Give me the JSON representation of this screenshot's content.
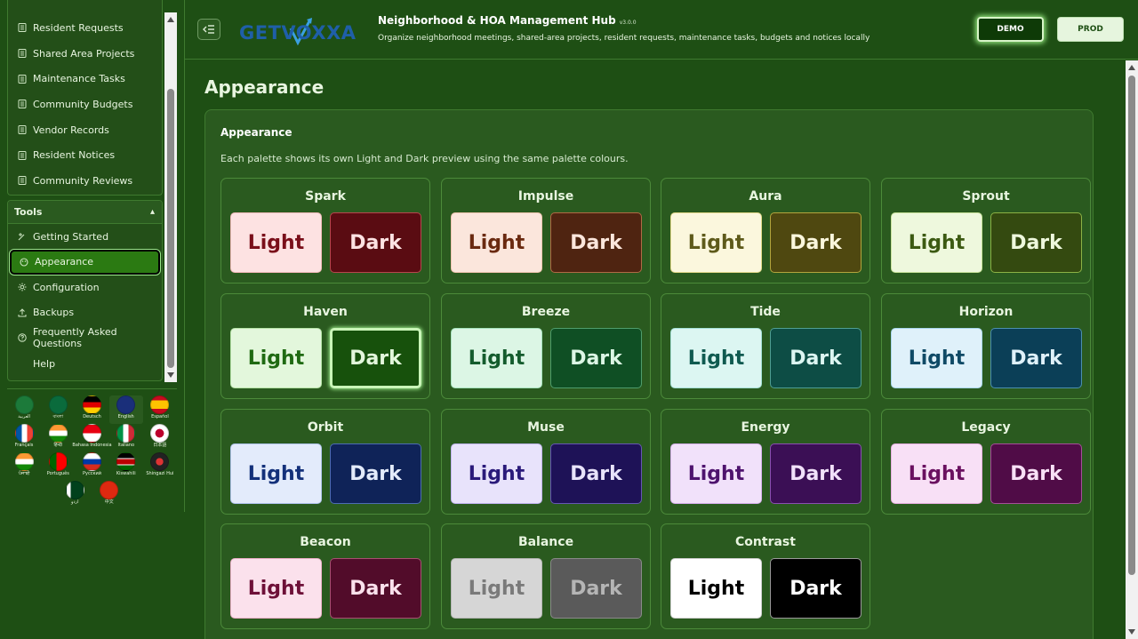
{
  "sidebar": {
    "top_items": [
      {
        "label": "Resident Requests",
        "icon": "list-icon"
      },
      {
        "label": "Shared Area Projects",
        "icon": "list-icon"
      },
      {
        "label": "Maintenance Tasks",
        "icon": "list-icon"
      },
      {
        "label": "Community Budgets",
        "icon": "list-icon"
      },
      {
        "label": "Vendor Records",
        "icon": "list-icon"
      },
      {
        "label": "Resident Notices",
        "icon": "list-icon"
      },
      {
        "label": "Community Reviews",
        "icon": "list-icon"
      }
    ],
    "tools_title": "Tools",
    "tools_items": [
      {
        "label": "Getting Started",
        "icon": "wand-icon"
      },
      {
        "label": "Appearance",
        "icon": "palette-icon",
        "active": true
      },
      {
        "label": "Configuration",
        "icon": "gear-icon"
      },
      {
        "label": "Backups",
        "icon": "upload-icon"
      },
      {
        "label": "Frequently Asked Questions",
        "icon": "question-icon"
      },
      {
        "label": "Help",
        "icon": ""
      }
    ],
    "languages": [
      [
        "العربية",
        "বাংলা",
        "Deutsch",
        "English",
        "Español"
      ],
      [
        "Français",
        "हिन्दी",
        "Bahasa Indonesia",
        "Italiano",
        "日本語"
      ],
      [
        "ਪੰਜਾਬੀ",
        "Português",
        "Русский",
        "Kiswahili",
        "Shingazi Hui"
      ],
      [
        "اردو",
        "中文"
      ]
    ]
  },
  "header": {
    "logo_text": "GETVOXXA",
    "title": "Neighborhood & HOA Management Hub",
    "version": "v3.0.0",
    "subtitle": "Organize neighborhood meetings, shared-area projects, resident requests, maintenance tasks, budgets and notices locally",
    "demo_label": "DEMO",
    "prod_label": "PROD"
  },
  "main": {
    "page_title": "Appearance",
    "card_title": "Appearance",
    "card_desc": "Each palette shows its own Light and Dark preview using the same palette colours.",
    "light_label": "Light",
    "dark_label": "Dark",
    "palettes": [
      {
        "name": "Spark",
        "light_bg": "#fde2e2",
        "light_fg": "#7a0f1a",
        "light_border": "#f2b9b9",
        "dark_bg": "#5a0c12",
        "dark_fg": "#fde2e2",
        "dark_border": "#b8454d"
      },
      {
        "name": "Impulse",
        "light_bg": "#fbe6dc",
        "light_fg": "#6a2a10",
        "light_border": "#eec3ae",
        "dark_bg": "#4f2411",
        "dark_fg": "#fbe6dc",
        "dark_border": "#b06a45"
      },
      {
        "name": "Aura",
        "light_bg": "#fbf7dd",
        "light_fg": "#5e5a1a",
        "light_border": "#e3d98a",
        "dark_bg": "#4f4810",
        "dark_fg": "#fbf7dd",
        "dark_border": "#b3a53d"
      },
      {
        "name": "Sprout",
        "light_bg": "#eef8dd",
        "light_fg": "#3c5a12",
        "light_border": "#c7e29a",
        "dark_bg": "#344a10",
        "dark_fg": "#eef8dd",
        "dark_border": "#8cb245"
      },
      {
        "name": "Haven",
        "light_bg": "#e3f7dc",
        "light_fg": "#1f6a12",
        "light_border": "#b7e3a8",
        "dark_bg": "#17510c",
        "dark_fg": "#e3f7dc",
        "dark_border": "#5fa04a"
      },
      {
        "name": "Breeze",
        "light_bg": "#dcf6e5",
        "light_fg": "#145c2d",
        "light_border": "#a7e2bd",
        "dark_bg": "#0f4f24",
        "dark_fg": "#dcf6e5",
        "dark_border": "#4f9d6c"
      },
      {
        "name": "Tide",
        "light_bg": "#dcf6f2",
        "light_fg": "#0f5a50",
        "light_border": "#a5e0d7",
        "dark_bg": "#0d4d45",
        "dark_fg": "#dcf6f2",
        "dark_border": "#4f9e93"
      },
      {
        "name": "Horizon",
        "light_bg": "#dff1fa",
        "light_fg": "#0f4a66",
        "light_border": "#a8d6ec",
        "dark_bg": "#0b3f57",
        "dark_fg": "#dff1fa",
        "dark_border": "#4c8fae"
      },
      {
        "name": "Orbit",
        "light_bg": "#e3ebfb",
        "light_fg": "#13307a",
        "light_border": "#b0c3ee",
        "dark_bg": "#0f2358",
        "dark_fg": "#e3ebfb",
        "dark_border": "#4d6cb3"
      },
      {
        "name": "Muse",
        "light_bg": "#e8e3fb",
        "light_fg": "#2a1a7a",
        "light_border": "#c0b3ef",
        "dark_bg": "#1e1257",
        "dark_fg": "#e8e3fb",
        "dark_border": "#6656b3"
      },
      {
        "name": "Energy",
        "light_bg": "#f1e1fa",
        "light_fg": "#4e136e",
        "light_border": "#d6afec",
        "dark_bg": "#3b0f55",
        "dark_fg": "#f1e1fa",
        "dark_border": "#8a4fb0"
      },
      {
        "name": "Legacy",
        "light_bg": "#f8e0f6",
        "light_fg": "#6a1060",
        "light_border": "#e7afe0",
        "dark_bg": "#500c47",
        "dark_fg": "#f8e0f6",
        "dark_border": "#a54e98"
      },
      {
        "name": "Beacon",
        "light_bg": "#fbe1ec",
        "light_fg": "#6e1038",
        "light_border": "#eeb1ca",
        "dark_bg": "#520c2a",
        "dark_fg": "#fbe1ec",
        "dark_border": "#a84f72"
      },
      {
        "name": "Balance",
        "light_bg": "#d6d6d6",
        "light_fg": "#7a7a7a",
        "light_border": "#b5b5b5",
        "dark_bg": "#5a5a5a",
        "dark_fg": "#b5b5b5",
        "dark_border": "#8a8a8a"
      },
      {
        "name": "Contrast",
        "light_bg": "#ffffff",
        "light_fg": "#000000",
        "light_border": "#cfcfcf",
        "dark_bg": "#000000",
        "dark_fg": "#ffffff",
        "dark_border": "#9a9a9a"
      }
    ],
    "selected_palette": "Haven",
    "selected_mode": "dark"
  }
}
